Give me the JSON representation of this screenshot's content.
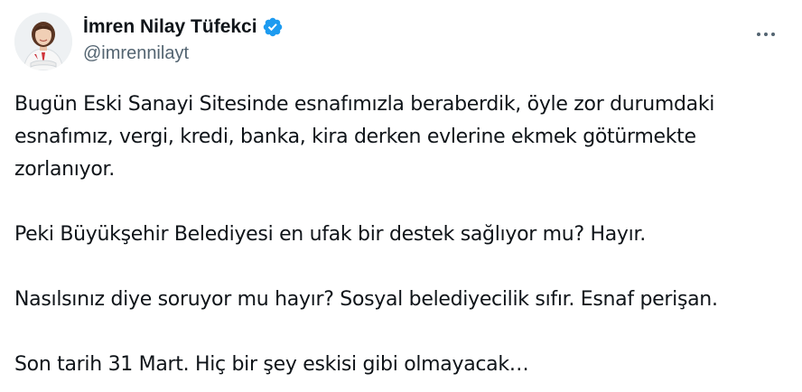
{
  "tweet": {
    "author": {
      "display_name": "İmren Nilay Tüfekci",
      "handle": "@imrennilayt",
      "verified": true
    },
    "more_icon": "more-horizontal-icon",
    "verified_icon": "verified-badge-icon",
    "verified_color": "#1d9bf0",
    "paragraphs": [
      "Bugün Eski Sanayi Sitesinde esnafımızla beraberdik, öyle zor durumdaki esnafımız, vergi, kredi, banka, kira derken evlerine ekmek götürmekte zorlanıyor.",
      "Peki Büyükşehir Belediyesi en ufak bir destek sağlıyor mu? Hayır.",
      "Nasılsınız diye soruyor mu hayır? Sosyal belediyecilik sıfır. Esnaf perişan.",
      "Son tarih 31 Mart. Hiç bir şey eskisi gibi olmayacak…"
    ]
  }
}
